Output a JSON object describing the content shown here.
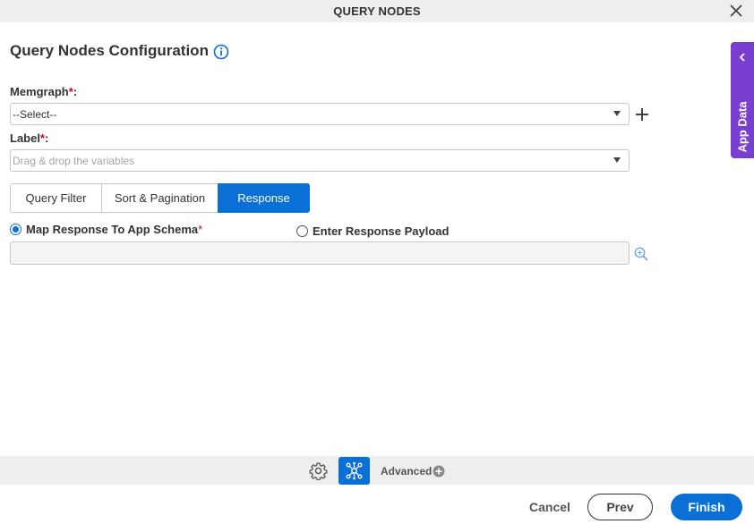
{
  "window": {
    "title": "QUERY NODES"
  },
  "main": {
    "heading": "Query Nodes Configuration",
    "memgraph": {
      "label": "Memgraph",
      "required_mark": "*",
      "colon": ":",
      "value": "--Select--"
    },
    "label_field": {
      "label": "Label",
      "required_mark": "*",
      "colon": ":",
      "placeholder": "Drag & drop the variables"
    },
    "tabs": [
      {
        "label": "Query Filter"
      },
      {
        "label": "Sort & Pagination"
      },
      {
        "label": "Response"
      }
    ],
    "active_tab": "Response",
    "response": {
      "option_map": "Map Response To App Schema",
      "option_map_required": "*",
      "option_payload": "Enter Response Payload",
      "selected": "Map Response To App Schema"
    }
  },
  "side_panel": {
    "label": "App Data"
  },
  "advanced": {
    "label": "Advanced"
  },
  "footer": {
    "cancel": "Cancel",
    "prev": "Prev",
    "finish": "Finish"
  },
  "colors": {
    "primary": "#0a70d6",
    "app_data": "#7a3fd1",
    "required": "#d0021b"
  }
}
